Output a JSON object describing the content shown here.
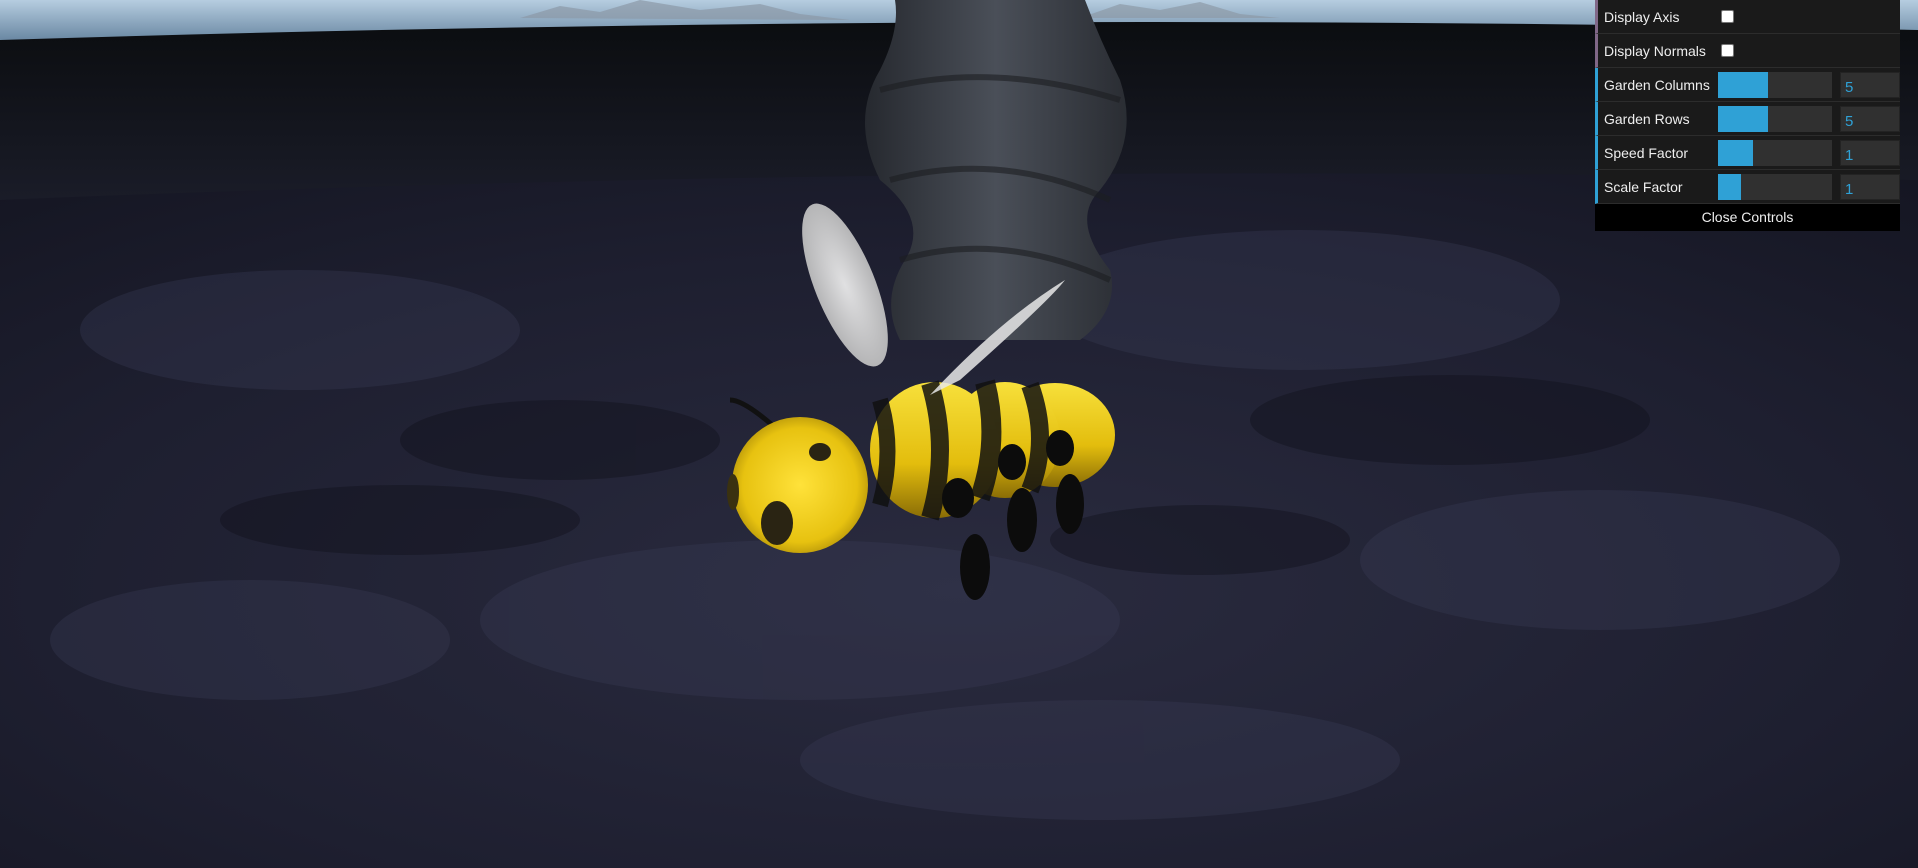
{
  "gui": {
    "controls": [
      {
        "label": "Display Axis",
        "type": "boolean",
        "checked": false
      },
      {
        "label": "Display Normals",
        "type": "boolean",
        "checked": false
      },
      {
        "label": "Garden Columns",
        "type": "number",
        "value": "5",
        "fill_fraction": 0.44
      },
      {
        "label": "Garden Rows",
        "type": "number",
        "value": "5",
        "fill_fraction": 0.44
      },
      {
        "label": "Speed Factor",
        "type": "number",
        "value": "1",
        "fill_fraction": 0.31
      },
      {
        "label": "Scale Factor",
        "type": "number",
        "value": "1",
        "fill_fraction": 0.2
      }
    ],
    "close_label": "Close Controls"
  },
  "scene": {
    "objects": [
      "terrain",
      "rock-pillar",
      "bee",
      "skybox-mountains"
    ]
  },
  "colors": {
    "accent": "#2fa1d6",
    "boolean_accent": "#806787",
    "bee_yellow": "#f2d11a"
  }
}
